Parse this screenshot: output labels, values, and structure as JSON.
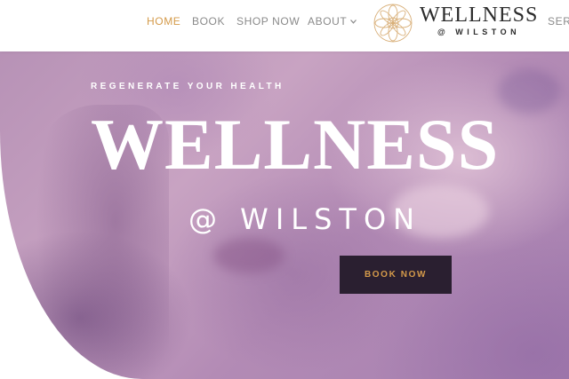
{
  "nav": {
    "items": [
      {
        "label": "HOME"
      },
      {
        "label": "BOOK"
      },
      {
        "label": "SHOP NOW"
      },
      {
        "label": "ABOUT"
      },
      {
        "label": "SERV"
      }
    ]
  },
  "logo": {
    "name": "WELLNESS",
    "sub": "@ WILSTON"
  },
  "hero": {
    "eyebrow": "REGENERATE YOUR HEALTH",
    "title": "WELLNESS",
    "subtitle": "@ WILSTON",
    "cta": "BOOK NOW"
  },
  "colors": {
    "accent": "#d49a4a",
    "button_bg": "#2a1f30",
    "nav_text": "#8a8a8a"
  }
}
